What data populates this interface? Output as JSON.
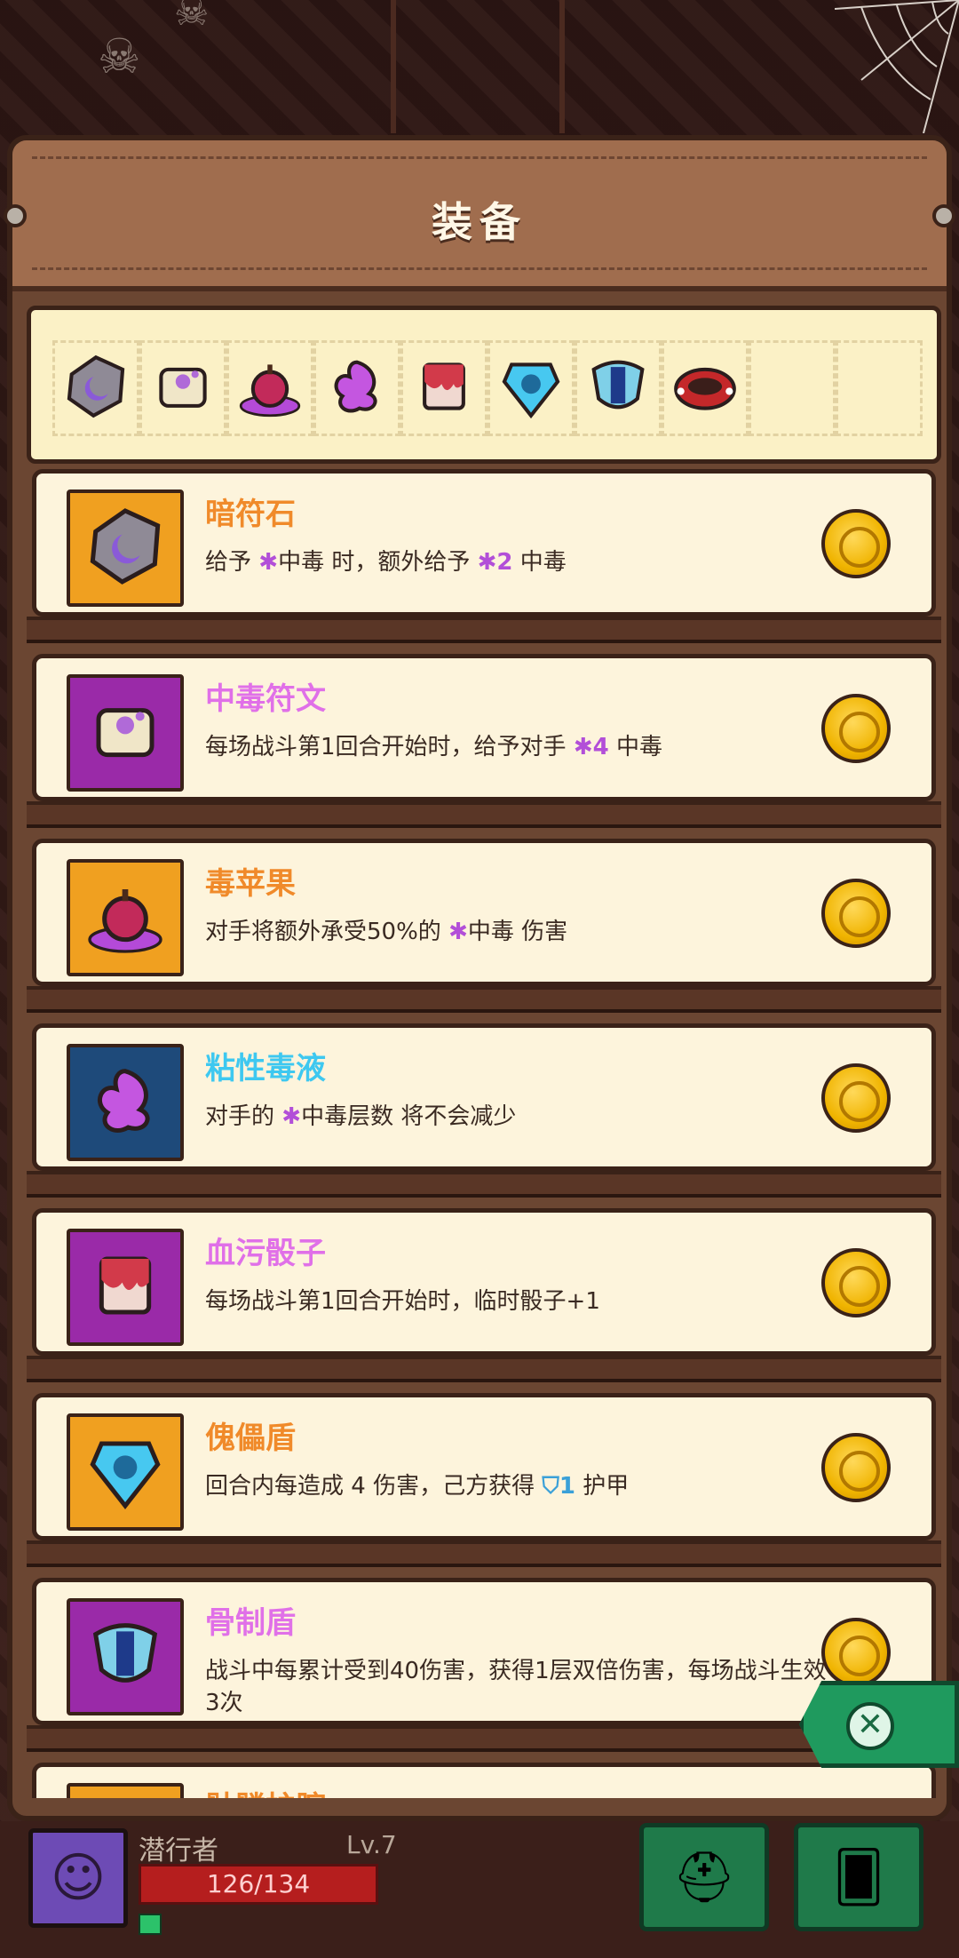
{
  "panel": {
    "title": "装备"
  },
  "equipment_slots": [
    {
      "icon": "dark-rune-stone-icon"
    },
    {
      "icon": "poison-scroll-icon"
    },
    {
      "icon": "poison-apple-icon"
    },
    {
      "icon": "sticky-venom-icon"
    },
    {
      "icon": "bloody-dice-icon"
    },
    {
      "icon": "puppet-shield-icon"
    },
    {
      "icon": "bone-shield-icon"
    },
    {
      "icon": "spiked-bracelet-icon"
    },
    {
      "icon": "empty-slot"
    },
    {
      "icon": "empty-slot"
    }
  ],
  "items": [
    {
      "name": "暗符石",
      "name_color": "#f08a2a",
      "box_color": "#f0a020",
      "icon": "dark-rune-stone-icon",
      "desc_parts": [
        "给予 ",
        "✱",
        "中毒 时，额外给予 ",
        "✱2",
        " 中毒"
      ]
    },
    {
      "name": "中毒符文",
      "name_color": "#e070e8",
      "box_color": "#9a2aa8",
      "icon": "poison-scroll-icon",
      "desc_parts": [
        "每场战斗第1回合开始时，给予对手 ",
        "✱4",
        " 中毒"
      ]
    },
    {
      "name": "毒苹果",
      "name_color": "#f08a2a",
      "box_color": "#f0a020",
      "icon": "poison-apple-icon",
      "desc_parts": [
        "对手将额外承受50%的 ",
        "✱",
        "中毒 伤害"
      ]
    },
    {
      "name": "粘性毒液",
      "name_color": "#3ec8f0",
      "box_color": "#1e4a7a",
      "icon": "sticky-venom-icon",
      "desc_parts": [
        "对手的 ",
        "✱",
        "中毒层数 将不会减少"
      ]
    },
    {
      "name": "血污骰子",
      "name_color": "#e070e8",
      "box_color": "#9a2aa8",
      "icon": "bloody-dice-icon",
      "desc_parts": [
        "每场战斗第1回合开始时，临时骰子+1"
      ]
    },
    {
      "name": "傀儡盾",
      "name_color": "#f08a2a",
      "box_color": "#f0a020",
      "icon": "puppet-shield-icon",
      "desc_parts": [
        "回合内每造成 4 伤害，己方获得 ",
        "⛉1",
        " 护甲"
      ]
    },
    {
      "name": "骨制盾",
      "name_color": "#e070e8",
      "box_color": "#9a2aa8",
      "icon": "bone-shield-icon",
      "desc_parts": [
        "战斗中每累计受到40伤害，获得1层双倍伤害，每场战斗生效3次"
      ]
    },
    {
      "name": "骷髅护腕",
      "name_color": "#f08a2a",
      "box_color": "#f0a020",
      "icon": "spiked-bracelet-icon",
      "desc_parts": [
        ""
      ]
    }
  ],
  "player": {
    "name": "潜行者",
    "level": "Lv.7",
    "hp_text": "126/134",
    "hp_color": "#b51e1e"
  },
  "bottom_buttons": [
    {
      "label": "",
      "icon": "helmet-icon"
    },
    {
      "label": "",
      "icon": "cards-icon"
    }
  ]
}
